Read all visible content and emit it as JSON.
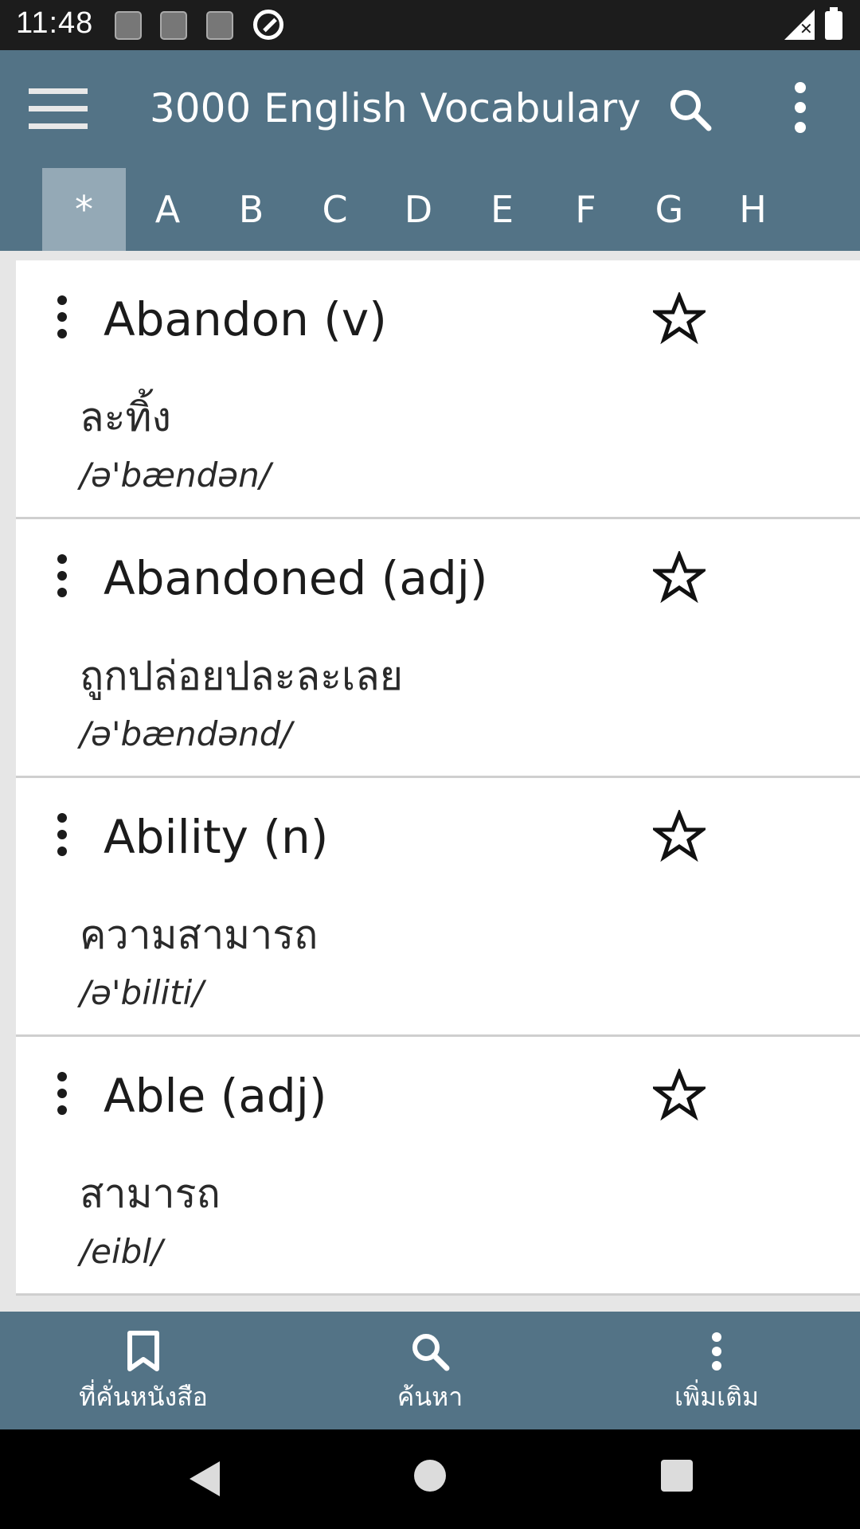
{
  "status_bar": {
    "time": "11:48"
  },
  "app_bar": {
    "title": "3000 English Vocabulary"
  },
  "tabs": [
    "*",
    "A",
    "B",
    "C",
    "D",
    "E",
    "F",
    "G",
    "H"
  ],
  "active_tab": "*",
  "words": [
    {
      "word": "Abandon (v)",
      "meaning": "ละทิ้ง",
      "phonetic": "/ə'bændən/"
    },
    {
      "word": "Abandoned (adj)",
      "meaning": "ถูกปล่อยปละละเลย",
      "phonetic": "/ə'bændənd/"
    },
    {
      "word": "Ability (n)",
      "meaning": "ความสามารถ",
      "phonetic": "/ə'biliti/"
    },
    {
      "word": "Able (adj)",
      "meaning": "สามารถ",
      "phonetic": "/eibl/"
    }
  ],
  "bottom_nav": {
    "bookmarks": "ที่คั่นหนังสือ",
    "search": "ค้นหา",
    "more": "เพิ่มเติม"
  },
  "colors": {
    "primary": "#537386",
    "active_tab": "#94a9b6"
  }
}
